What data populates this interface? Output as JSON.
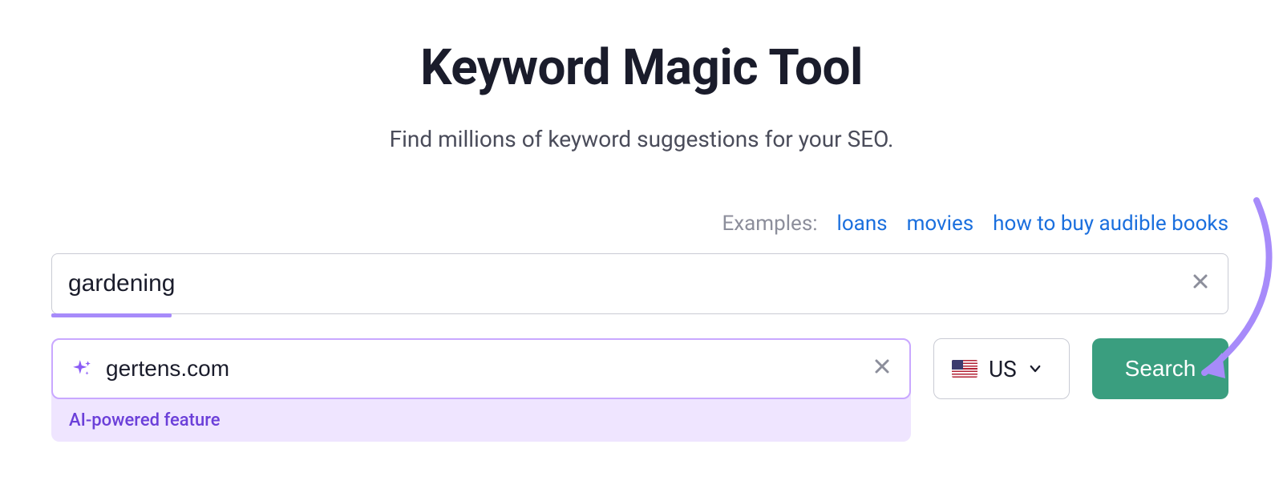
{
  "header": {
    "title": "Keyword Magic Tool",
    "subtitle": "Find millions of keyword suggestions for your SEO."
  },
  "examples": {
    "label": "Examples:",
    "items": [
      "loans",
      "movies",
      "how to buy audible books"
    ]
  },
  "keyword": {
    "value": "gardening"
  },
  "domain": {
    "value": "gertens.com",
    "ai_caption": "AI-powered feature"
  },
  "database": {
    "selected_label": "US"
  },
  "actions": {
    "search_label": "Search"
  }
}
